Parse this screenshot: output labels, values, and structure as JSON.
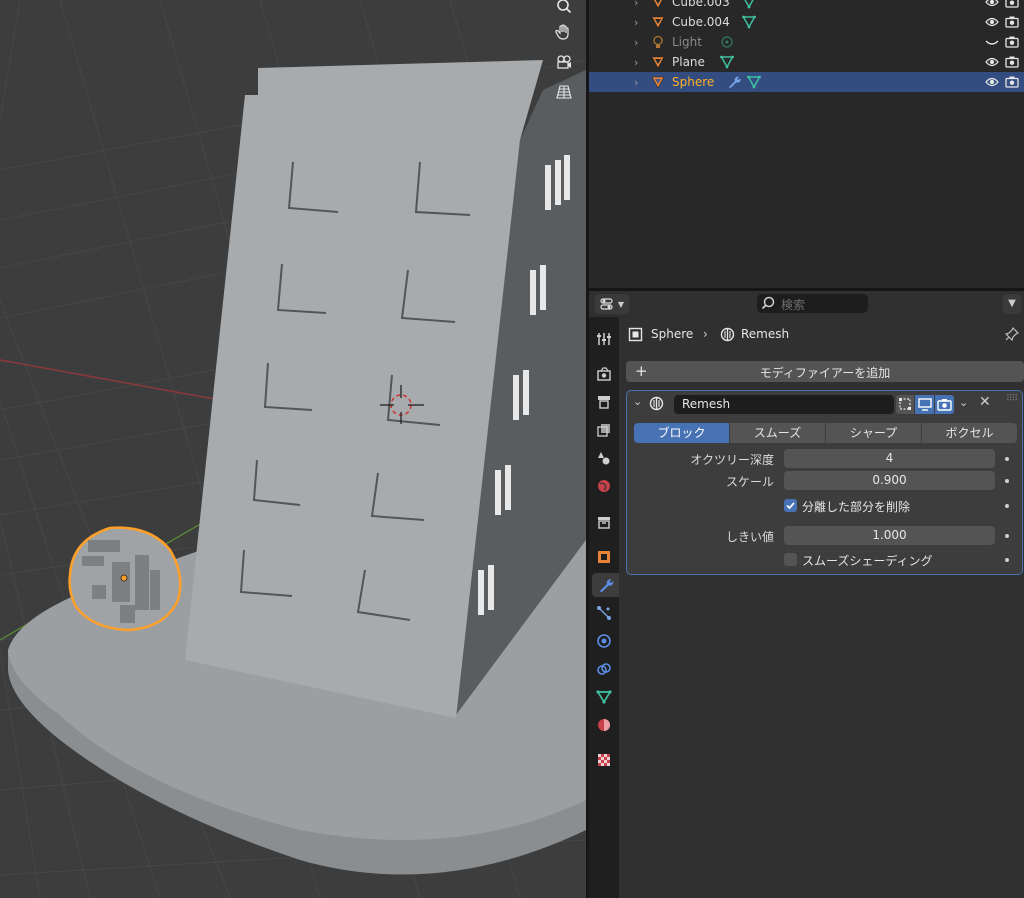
{
  "outliner": {
    "items": [
      {
        "name": "Cube.003",
        "type": "mesh",
        "state": "normal"
      },
      {
        "name": "Cube.004",
        "type": "mesh",
        "state": "normal"
      },
      {
        "name": "Light",
        "type": "light",
        "state": "dim"
      },
      {
        "name": "Plane",
        "type": "mesh",
        "state": "normal"
      },
      {
        "name": "Sphere",
        "type": "mesh",
        "state": "selected",
        "has_modifier": true
      }
    ]
  },
  "properties": {
    "search_placeholder": "検索",
    "breadcrumb": {
      "object": "Sphere",
      "modifier": "Remesh"
    },
    "add_modifier_label": "モディファイアーを追加",
    "modifier": {
      "name": "Remesh",
      "modes": [
        "ブロック",
        "スムーズ",
        "シャープ",
        "ボクセル"
      ],
      "active_mode": "ブロック",
      "octree_depth": {
        "label": "オクツリー深度",
        "value": "4"
      },
      "scale": {
        "label": "スケール",
        "value": "0.900"
      },
      "remove_disconnected": {
        "label": "分離した部分を削除",
        "checked": true
      },
      "threshold": {
        "label": "しきい値",
        "value": "1.000"
      },
      "smooth_shading": {
        "label": "スムーズシェーディング",
        "checked": false
      }
    }
  },
  "colors": {
    "accent": "#4772b3",
    "selection": "#ffaf29",
    "mesh_icon": "#e8833a",
    "data_icon": "#3fc0a0"
  }
}
